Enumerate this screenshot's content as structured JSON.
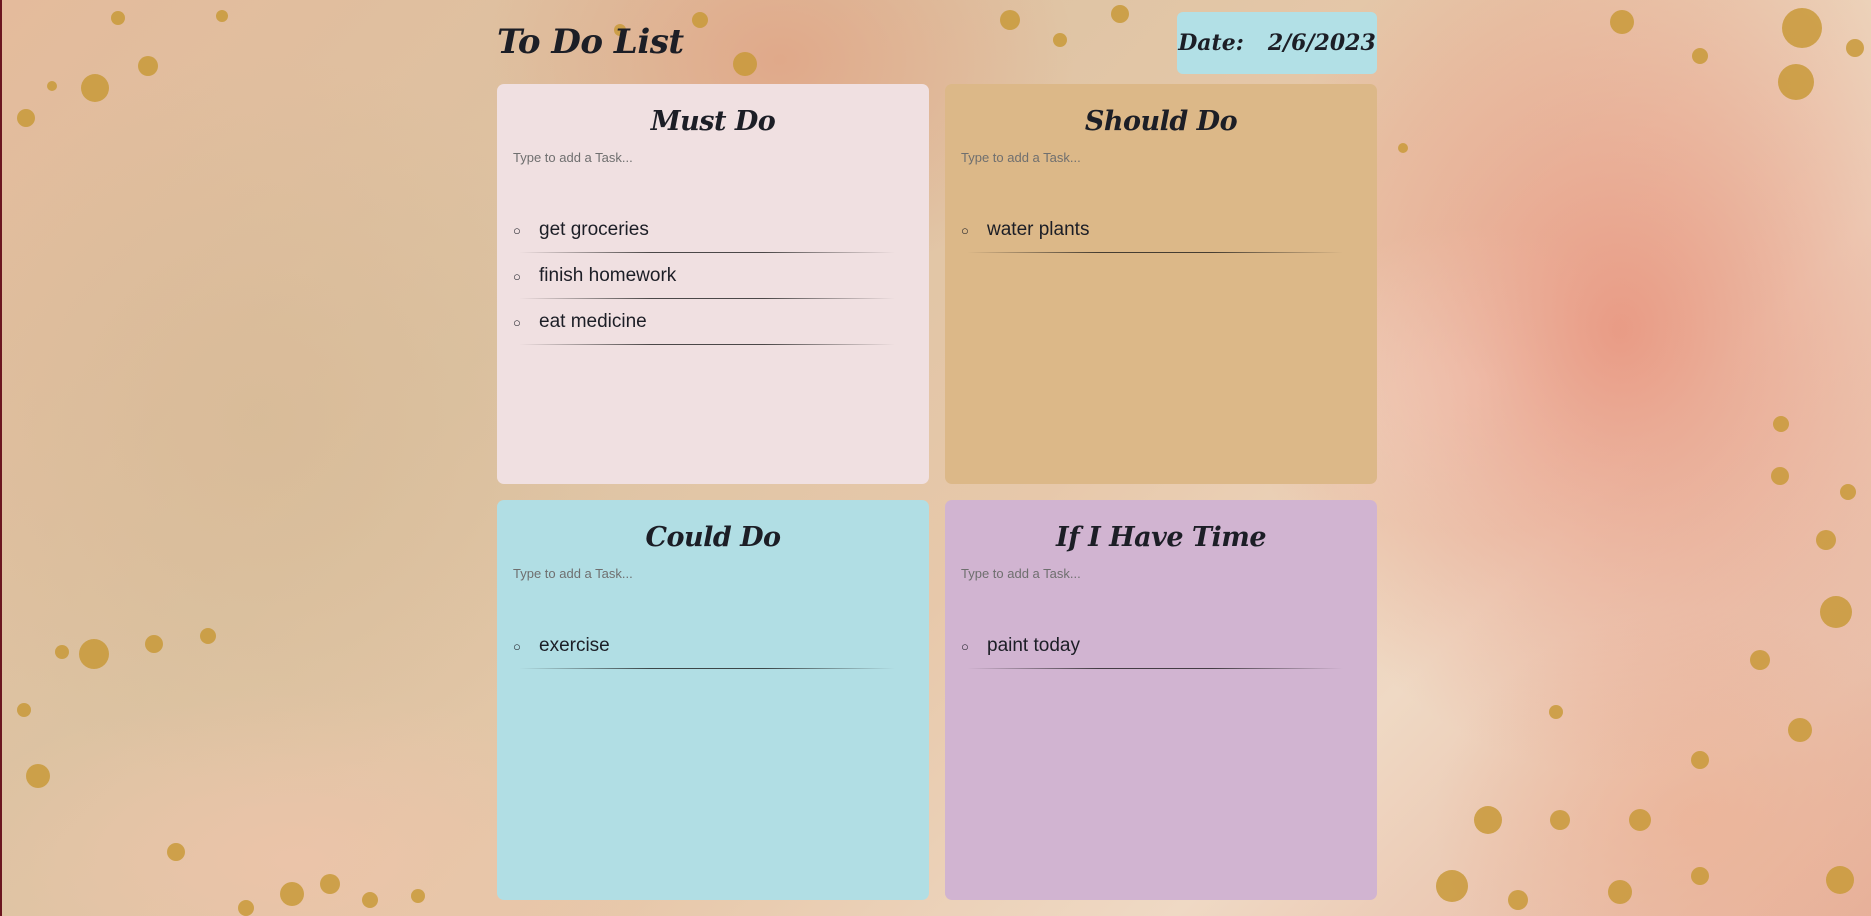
{
  "app": {
    "title": "To Do List"
  },
  "date": {
    "label": "Date:",
    "value": "2/6/2023"
  },
  "theme": {
    "must_do_color": "#f0e0e1",
    "should_do_color": "#dcb888",
    "could_do_color": "#b1dee4",
    "if_i_have_time_color": "#d1b4d1",
    "date_box_color": "#b2e0e6"
  },
  "lists": {
    "must_do": {
      "title": "Must Do",
      "placeholder": "Type to add a Task...",
      "tasks": [
        "get groceries",
        "finish homework",
        "eat medicine"
      ]
    },
    "should_do": {
      "title": "Should Do",
      "placeholder": "Type to add a Task...",
      "tasks": [
        "water plants"
      ]
    },
    "could_do": {
      "title": "Could Do",
      "placeholder": "Type to add a Task...",
      "tasks": [
        "exercise"
      ]
    },
    "if_i_have_time": {
      "title": "If I Have Time",
      "placeholder": "Type to add a Task...",
      "tasks": [
        "paint today"
      ]
    }
  },
  "icons": {
    "task_bullet": "circle-bullet-icon"
  }
}
